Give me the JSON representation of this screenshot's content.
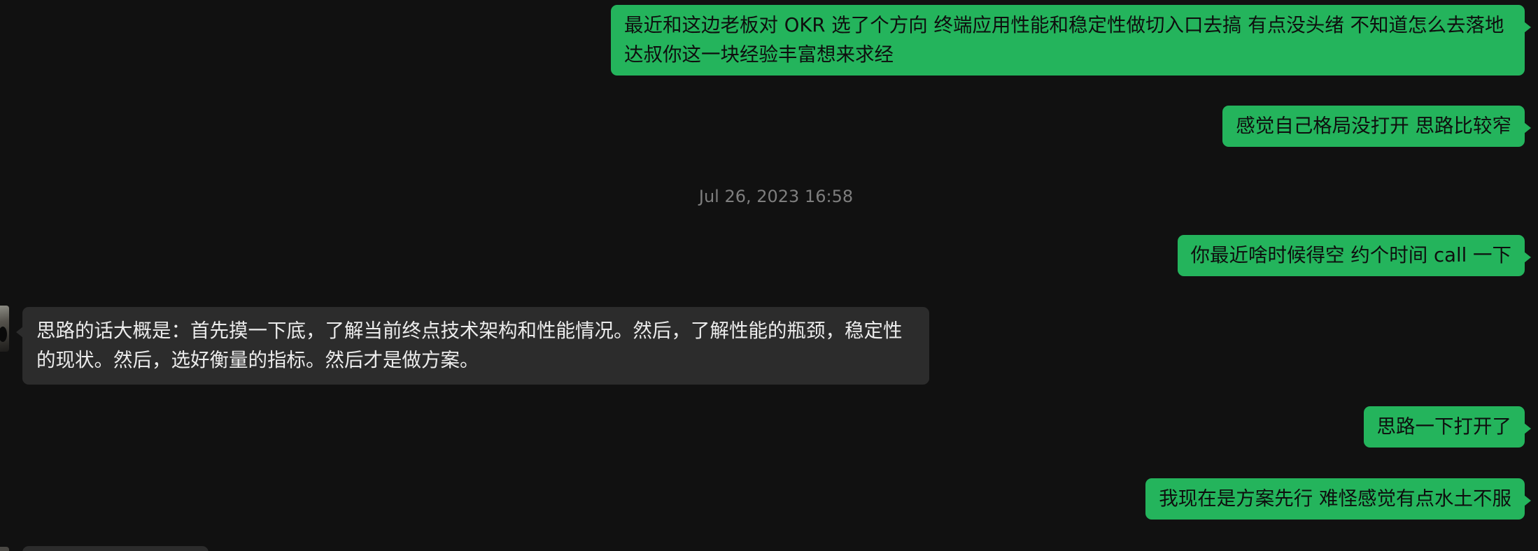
{
  "chat": {
    "messages": [
      {
        "direction": "outgoing",
        "text": "最近和这边老板对 OKR 选了个方向 终端应用性能和稳定性做切入口去搞 有点没头绪 不知道怎么去落地 达叔你这一块经验丰富想来求经"
      },
      {
        "direction": "outgoing",
        "text": "感觉自己格局没打开 思路比较窄"
      },
      {
        "direction": "outgoing",
        "text": "你最近啥时候得空 约个时间 call 一下"
      },
      {
        "direction": "incoming",
        "text": "思路的话大概是：首先摸一下底，了解当前终点技术架构和性能情况。然后，了解性能的瓶颈，稳定性的现状。然后，选好衡量的指标。然后才是做方案。"
      },
      {
        "direction": "outgoing",
        "text": "思路一下打开了"
      },
      {
        "direction": "outgoing",
        "text": "我现在是方案先行 难怪感觉有点水土不服"
      }
    ],
    "timestamp": "Jul 26, 2023 16:58"
  },
  "colors": {
    "background": "#111111",
    "outgoing_bubble": "#24b45c",
    "incoming_bubble": "#2c2c2c",
    "timestamp_text": "#7e7e7e"
  }
}
